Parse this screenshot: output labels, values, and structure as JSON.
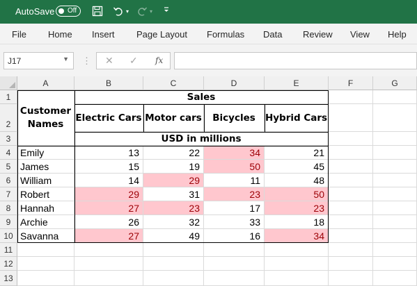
{
  "titlebar": {
    "autosave_label": "AutoSave",
    "autosave_state": "Off",
    "save_icon": "save-icon",
    "undo_icon": "undo-icon",
    "redo_icon": "redo-icon",
    "customize_icon": "customize-toolbar-icon"
  },
  "menu": [
    "File",
    "Home",
    "Insert",
    "Page Layout",
    "Formulas",
    "Data",
    "Review",
    "View",
    "Help"
  ],
  "formula_bar": {
    "name_box": "J17",
    "fx_label": "fx",
    "formula": ""
  },
  "columns": [
    "A",
    "B",
    "C",
    "D",
    "E",
    "F",
    "G"
  ],
  "rows": [
    "1",
    "2",
    "3",
    "4",
    "5",
    "6",
    "7",
    "8",
    "9",
    "10",
    "11",
    "12",
    "13"
  ],
  "sheet": {
    "header_names": "Customer Names",
    "sales_title": "Sales",
    "units": "USD in millions",
    "product_headers": [
      "Electric Cars",
      "Motor cars",
      "Bicycles",
      "Hybrid Cars"
    ],
    "data": [
      {
        "name": "Emily",
        "values": [
          "13",
          "22",
          "34",
          "21"
        ],
        "highlight": [
          false,
          false,
          true,
          false
        ]
      },
      {
        "name": "James",
        "values": [
          "15",
          "19",
          "50",
          "45"
        ],
        "highlight": [
          false,
          false,
          true,
          false
        ]
      },
      {
        "name": "William",
        "values": [
          "14",
          "29",
          "11",
          "48"
        ],
        "highlight": [
          false,
          true,
          false,
          false
        ]
      },
      {
        "name": "Robert",
        "values": [
          "29",
          "31",
          "23",
          "50"
        ],
        "highlight": [
          true,
          false,
          true,
          true
        ]
      },
      {
        "name": "Hannah",
        "values": [
          "27",
          "23",
          "17",
          "23"
        ],
        "highlight": [
          true,
          true,
          false,
          true
        ]
      },
      {
        "name": "Archie",
        "values": [
          "26",
          "32",
          "33",
          "18"
        ],
        "highlight": [
          false,
          false,
          false,
          false
        ]
      },
      {
        "name": "Savanna",
        "values": [
          "27",
          "49",
          "16",
          "34"
        ],
        "highlight": [
          true,
          false,
          false,
          true
        ]
      }
    ]
  },
  "colors": {
    "ribbon": "#217346",
    "highlight_fill": "#ffc7ce",
    "highlight_text": "#9c0006"
  }
}
